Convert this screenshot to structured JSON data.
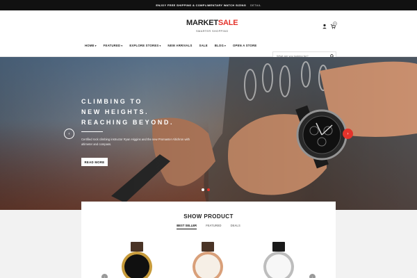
{
  "topbar": {
    "promo": "ENJOY FREE SHIPPING & COMPLIMENTARY WATCH SIZING",
    "details": "DETAIL"
  },
  "header": {
    "logo_main": "MARKET",
    "logo_accent": "SALE",
    "logo_sub": "SMARTER SHOPPING",
    "cart_count": "0",
    "search_placeholder": "What are you looking for?"
  },
  "nav": {
    "items": [
      {
        "label": "HOME",
        "caret": "▾"
      },
      {
        "label": "FEATURED",
        "caret": "▾"
      },
      {
        "label": "EXPLORE STORES",
        "caret": "▾"
      },
      {
        "label": "NEW ARRIVALS",
        "caret": ""
      },
      {
        "label": "SALE",
        "caret": ""
      },
      {
        "label": "BLOG",
        "caret": "▾"
      },
      {
        "label": "OPEN A STORE",
        "caret": ""
      }
    ]
  },
  "hero": {
    "headline_1": "CLIMBING TO",
    "headline_2": "NEW HEIGHTS.",
    "headline_3": "REACHING BEYOND.",
    "subtext": "Certified rock climbing instructor Ryan Higgins and the new Promaster Altichron with altimeter and compass.",
    "button": "READ MORE",
    "prev": "‹",
    "next": "›"
  },
  "products": {
    "title": "SHOW PRODUCT",
    "tabs": [
      "BEST SELLER",
      "FEATURED",
      "DEALS"
    ],
    "prev": "‹",
    "next": "›"
  },
  "colors": {
    "accent": "#e4332b",
    "dark": "#111111"
  }
}
